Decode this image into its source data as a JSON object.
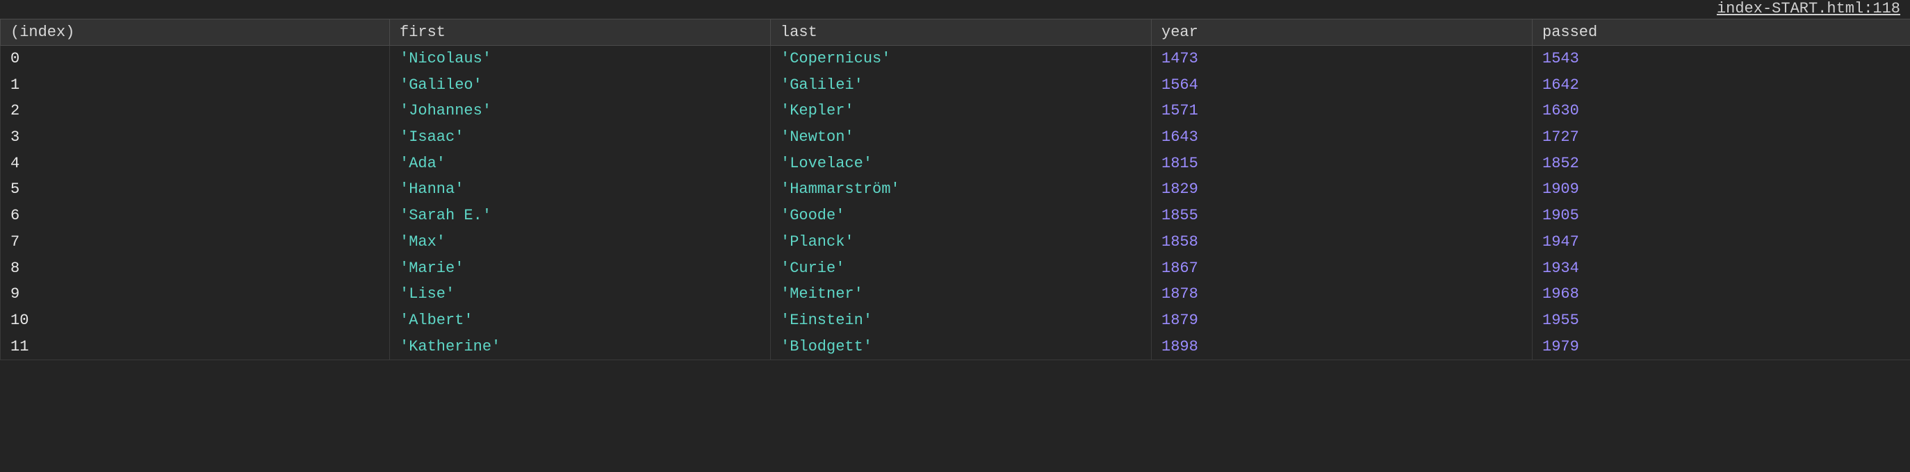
{
  "source_link": "index-START.html:118",
  "columns": {
    "index": "(index)",
    "first": "first",
    "last": "last",
    "year": "year",
    "passed": "passed"
  },
  "rows": [
    {
      "index": 0,
      "first": "'Nicolaus'",
      "last": "'Copernicus'",
      "year": 1473,
      "passed": 1543
    },
    {
      "index": 1,
      "first": "'Galileo'",
      "last": "'Galilei'",
      "year": 1564,
      "passed": 1642
    },
    {
      "index": 2,
      "first": "'Johannes'",
      "last": "'Kepler'",
      "year": 1571,
      "passed": 1630
    },
    {
      "index": 3,
      "first": "'Isaac'",
      "last": "'Newton'",
      "year": 1643,
      "passed": 1727
    },
    {
      "index": 4,
      "first": "'Ada'",
      "last": "'Lovelace'",
      "year": 1815,
      "passed": 1852
    },
    {
      "index": 5,
      "first": "'Hanna'",
      "last": "'Hammarström'",
      "year": 1829,
      "passed": 1909
    },
    {
      "index": 6,
      "first": "'Sarah E.'",
      "last": "'Goode'",
      "year": 1855,
      "passed": 1905
    },
    {
      "index": 7,
      "first": "'Max'",
      "last": "'Planck'",
      "year": 1858,
      "passed": 1947
    },
    {
      "index": 8,
      "first": "'Marie'",
      "last": "'Curie'",
      "year": 1867,
      "passed": 1934
    },
    {
      "index": 9,
      "first": "'Lise'",
      "last": "'Meitner'",
      "year": 1878,
      "passed": 1968
    },
    {
      "index": 10,
      "first": "'Albert'",
      "last": "'Einstein'",
      "year": 1879,
      "passed": 1955
    },
    {
      "index": 11,
      "first": "'Katherine'",
      "last": "'Blodgett'",
      "year": 1898,
      "passed": 1979
    }
  ]
}
